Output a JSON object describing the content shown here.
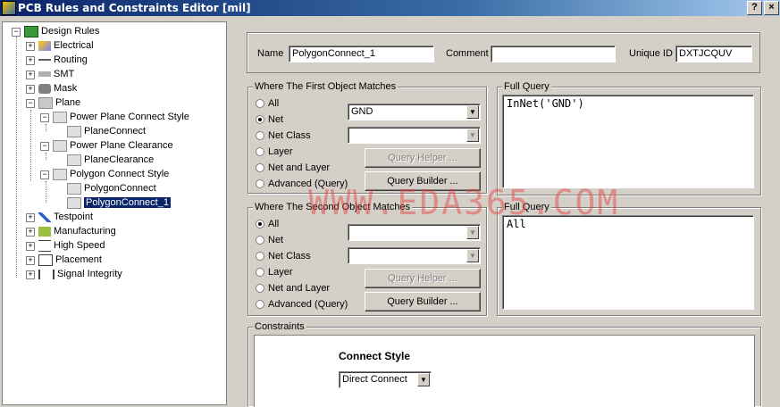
{
  "window": {
    "title": "PCB Rules and Constraints Editor [mil]",
    "help_label": "?",
    "close_label": "×"
  },
  "tree": {
    "root": "Design Rules",
    "items": [
      {
        "label": "Electrical"
      },
      {
        "label": "Routing"
      },
      {
        "label": "SMT"
      },
      {
        "label": "Mask"
      },
      {
        "label": "Plane"
      },
      {
        "label": "Power Plane Connect Style"
      },
      {
        "label": "PlaneConnect"
      },
      {
        "label": "Power Plane Clearance"
      },
      {
        "label": "PlaneClearance"
      },
      {
        "label": "Polygon Connect Style"
      },
      {
        "label": "PolygonConnect"
      },
      {
        "label": "PolygonConnect_1"
      },
      {
        "label": "Testpoint"
      },
      {
        "label": "Manufacturing"
      },
      {
        "label": "High Speed"
      },
      {
        "label": "Placement"
      },
      {
        "label": "Signal Integrity"
      }
    ]
  },
  "header": {
    "name_label": "Name",
    "name_value": "PolygonConnect_1",
    "comment_label": "Comment",
    "comment_value": "",
    "unique_id_label": "Unique ID",
    "unique_id_value": "DXTJCQUV"
  },
  "first": {
    "title": "Where The First Object Matches",
    "options": [
      "All",
      "Net",
      "Net Class",
      "Layer",
      "Net and Layer",
      "Advanced (Query)"
    ],
    "selected": "Net",
    "net_value": "GND",
    "netclass_value": "",
    "query_helper": "Query Helper ...",
    "query_builder": "Query Builder ...",
    "full_query_title": "Full Query",
    "full_query": "InNet('GND')"
  },
  "second": {
    "title": "Where The Second Object Matches",
    "options": [
      "All",
      "Net",
      "Net Class",
      "Layer",
      "Net and Layer",
      "Advanced (Query)"
    ],
    "selected": "All",
    "net_value": "",
    "netclass_value": "",
    "query_helper": "Query Helper ...",
    "query_builder": "Query Builder ...",
    "full_query_title": "Full Query",
    "full_query": "All"
  },
  "constraints": {
    "title": "Constraints",
    "connect_style_label": "Connect Style",
    "connect_style_value": "Direct Connect"
  },
  "watermark": "WWW.EDA365.COM"
}
